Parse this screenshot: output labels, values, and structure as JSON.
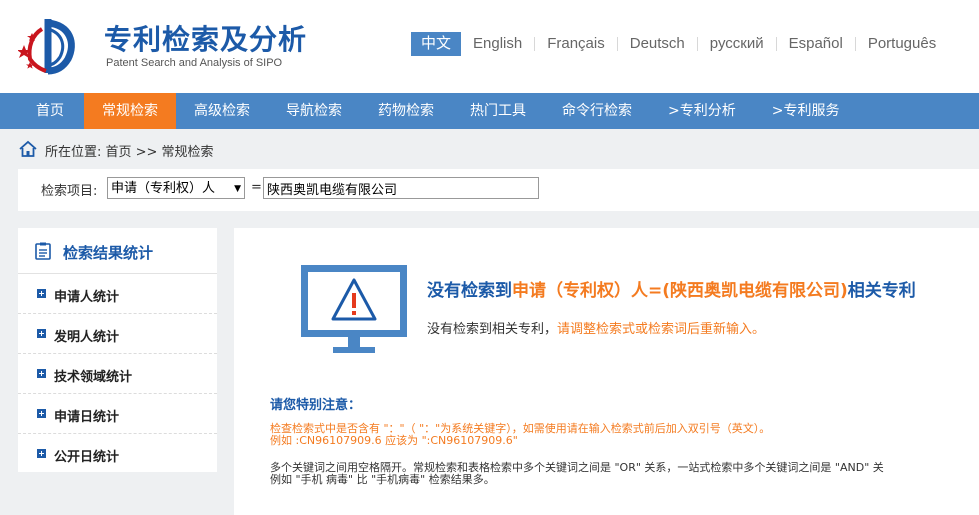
{
  "header": {
    "title": "专利检索及分析",
    "subtitle": "Patent Search and Analysis of SIPO",
    "languages": [
      "中文",
      "English",
      "Français",
      "Deutsch",
      "русский",
      "Español",
      "Português"
    ]
  },
  "nav": {
    "items": [
      "首页",
      "常规检索",
      "高级检索",
      "导航检索",
      "药物检索",
      "热门工具",
      "命令行检索",
      ">专利分析",
      ">专利服务"
    ],
    "active_index": 1
  },
  "breadcrumb": {
    "text": "所在位置: 首页 >> 常规检索"
  },
  "search": {
    "label": "检索项目:",
    "field": "申请（专利权）人",
    "eq": "=",
    "value": "陕西奥凯电缆有限公司"
  },
  "sidebar": {
    "title": "检索结果统计",
    "items": [
      "申请人统计",
      "发明人统计",
      "技术领域统计",
      "申请日统计",
      "公开日统计"
    ]
  },
  "result": {
    "title_prefix": "没有检索到",
    "title_highlight": "申请（专利权）人=(陕西奥凯电缆有限公司)",
    "title_suffix": "相关专利",
    "sub_prefix": "没有检索到相关专利，",
    "sub_highlight": "请调整检索式或检索词后重新输入。"
  },
  "notice": {
    "title": "请您特别注意：",
    "red_line1": "检查检索式中是否含有 \"：\"（ \"：\"为系统关键字），如需使用请在输入检索式前后加入双引号（英文）。",
    "red_line2": "例如 :CN96107909.6 应该为 \":CN96107909.6\"",
    "black_line1": "多个关键词之间用空格隔开。常规检索和表格检索中多个关键词之间是 \"OR\" 关系，一站式检索中多个关键词之间是 \"AND\" 关",
    "black_line2": "例如 \"手机 病毒\" 比 \"手机病毒\" 检索结果多。"
  },
  "colors": {
    "brand_blue": "#1c5aa8",
    "nav_blue": "#4a86c5",
    "accent_orange": "#f47b20"
  }
}
